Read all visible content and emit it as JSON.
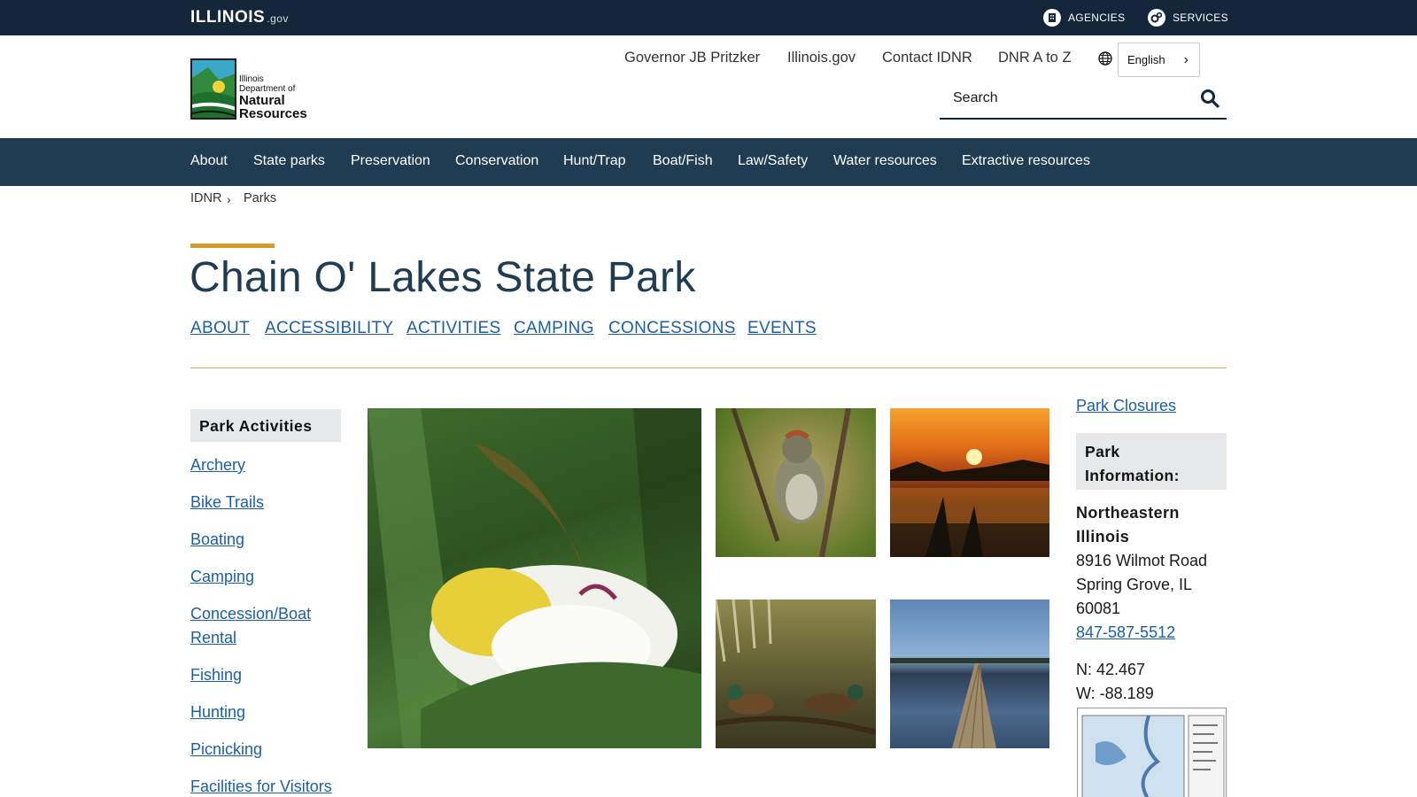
{
  "topbar": {
    "logo_main": "ILLINOIS",
    "logo_suffix": ".gov",
    "agencies": "AGENCIES",
    "services": "SERVICES"
  },
  "header": {
    "logo_line1": "Illinois",
    "logo_line2": "Department of",
    "logo_line3": "Natural",
    "logo_line4": "Resources",
    "links": [
      "Governor JB Pritzker",
      "Illinois.gov",
      "Contact IDNR",
      "DNR A to Z"
    ],
    "language": "English",
    "search_placeholder": "Search"
  },
  "nav": [
    "About",
    "State parks",
    "Preservation",
    "Conservation",
    "Hunt/Trap",
    "Boat/Fish",
    "Law/Safety",
    "Water resources",
    "Extractive resources"
  ],
  "breadcrumb": [
    "IDNR",
    "Parks"
  ],
  "page": {
    "title": "Chain O' Lakes State Park",
    "subnav": [
      "ABOUT",
      "ACCESSIBILITY",
      "ACTIVITIES",
      "CAMPING",
      "CONCESSIONS",
      "EVENTS"
    ]
  },
  "sidebar": {
    "heading": "Park Activities",
    "links": [
      "Archery",
      "Bike Trails",
      "Boating",
      "Camping",
      "Concession/Boat Rental",
      "Fishing",
      "Hunting",
      "Picnicking",
      "Facilities for Visitors"
    ]
  },
  "info": {
    "closures": "Park Closures",
    "heading": "Park Information:",
    "region": "Northeastern Illinois",
    "address_line1": "8916 Wilmot Road",
    "address_line2": "Spring Grove, IL",
    "address_line3": "60081",
    "phone": "847-587-5512",
    "lat": "N: 42.467",
    "lon": "W: -88.189"
  },
  "colors": {
    "topbar": "#14263a",
    "nav": "#1f3c53",
    "link": "#1b5fa8",
    "accent": "#d69a2d"
  }
}
